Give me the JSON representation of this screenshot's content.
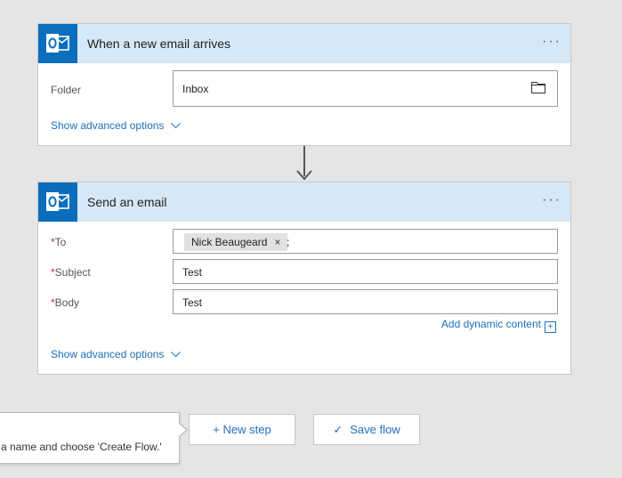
{
  "trigger_card": {
    "title": "When a new email arrives",
    "more": "···",
    "folder_label": "Folder",
    "folder_value": "Inbox",
    "show_advanced": "Show advanced options",
    "icon": "folder-icon"
  },
  "action_card": {
    "title": "Send an email",
    "more": "···",
    "to_label": "To",
    "to_token": "Nick Beaugeard",
    "to_token_remove": "×",
    "to_separator": ";",
    "subject_label": "Subject",
    "subject_value": "Test",
    "body_label": "Body",
    "body_value": "Test",
    "required_marker": "*",
    "add_dynamic": "Add dynamic content",
    "add_dynamic_icon": "+",
    "show_advanced": "Show advanced options"
  },
  "buttons": {
    "new_step": "+ New step",
    "save_flow_icon": "✓",
    "save_flow": "Save flow"
  },
  "callout": {
    "text": "a name and choose 'Create Flow.'"
  },
  "colors": {
    "accent": "#0a6ebd",
    "header_bg": "#d6e8f6",
    "link": "#1e6fb8",
    "page_bg": "#e5e5e5"
  }
}
